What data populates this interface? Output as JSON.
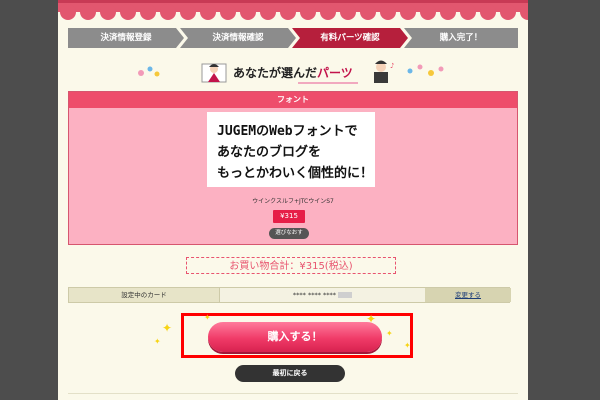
{
  "steps": [
    {
      "label": "決済情報登録",
      "state": "done"
    },
    {
      "label": "決済情報確認",
      "state": "done"
    },
    {
      "label": "有料パーツ確認",
      "state": "active"
    },
    {
      "label": "購入完了！",
      "state": "todo"
    }
  ],
  "heading": {
    "prefix": "あなたが選んだ",
    "accent": "パーツ"
  },
  "parts": {
    "category_label": "フォント",
    "preview_lines": [
      "JUGEMのWebフォントで",
      "あなたのブログを",
      "もっとかわいく個性的に！"
    ],
    "font_name": "ウインクスルフ+JTCウインS7",
    "price": "¥315",
    "reselect_label": "選びなおす"
  },
  "total": "お買い物合計：¥315(税込)",
  "card": {
    "label": "設定中のカード",
    "number_masked": "**** **** ****",
    "change_label": "変更する"
  },
  "purchase_label": "購入する！",
  "back_label": "最初に戻る",
  "colors": {
    "accent": "#e8546f",
    "active_step": "#b61f3c",
    "highlight_frame": "#ff0000"
  }
}
